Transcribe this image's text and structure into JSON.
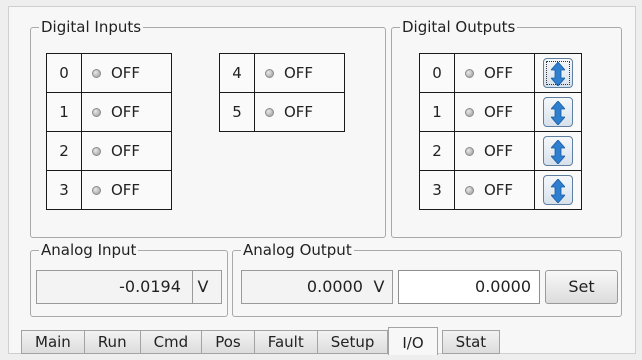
{
  "digital_inputs": {
    "title": "Digital Inputs",
    "left": [
      {
        "num": "0",
        "state": "OFF"
      },
      {
        "num": "1",
        "state": "OFF"
      },
      {
        "num": "2",
        "state": "OFF"
      },
      {
        "num": "3",
        "state": "OFF"
      }
    ],
    "right": [
      {
        "num": "4",
        "state": "OFF"
      },
      {
        "num": "5",
        "state": "OFF"
      }
    ]
  },
  "digital_outputs": {
    "title": "Digital Outputs",
    "rows": [
      {
        "num": "0",
        "state": "OFF"
      },
      {
        "num": "1",
        "state": "OFF"
      },
      {
        "num": "2",
        "state": "OFF"
      },
      {
        "num": "3",
        "state": "OFF"
      }
    ],
    "toggle_icon": "up-down-arrow-icon"
  },
  "analog_input": {
    "title": "Analog Input",
    "value": "-0.0194",
    "unit": "V"
  },
  "analog_output": {
    "title": "Analog Output",
    "value": "0.0000",
    "unit": "V",
    "input_value": "0.0000",
    "set_label": "Set"
  },
  "tabs": [
    "Main",
    "Run",
    "Cmd",
    "Pos",
    "Fault",
    "Setup",
    "I/O",
    "Stat"
  ],
  "active_tab": "I/O",
  "colors": {
    "toggle_arrow": "#2f7fd0",
    "led_off": "#b0b0b0"
  }
}
